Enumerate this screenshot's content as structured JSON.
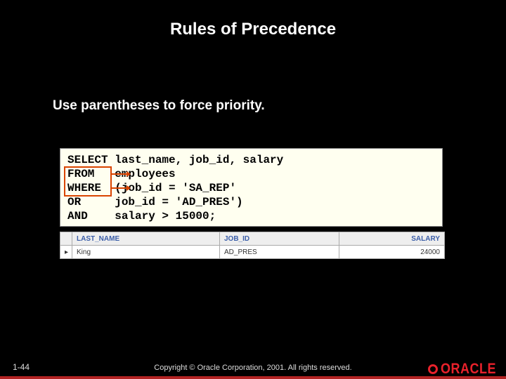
{
  "title": "Rules of Precedence",
  "subtitle": "Use parentheses to force priority.",
  "code": "SELECT last_name, job_id, salary\nFROM   employees\nWHERE  (job_id = 'SA_REP'\nOR     job_id = 'AD_PRES')\nAND    salary > 15000;",
  "results": {
    "headers": [
      "LAST_NAME",
      "JOB_ID",
      "SALARY"
    ],
    "rows": [
      {
        "last_name": "King",
        "job_id": "AD_PRES",
        "salary": "24000"
      }
    ]
  },
  "footer": {
    "page": "1-44",
    "copyright": "Copyright © Oracle Corporation, 2001. All rights reserved.",
    "logo_text": "ORACLE"
  }
}
